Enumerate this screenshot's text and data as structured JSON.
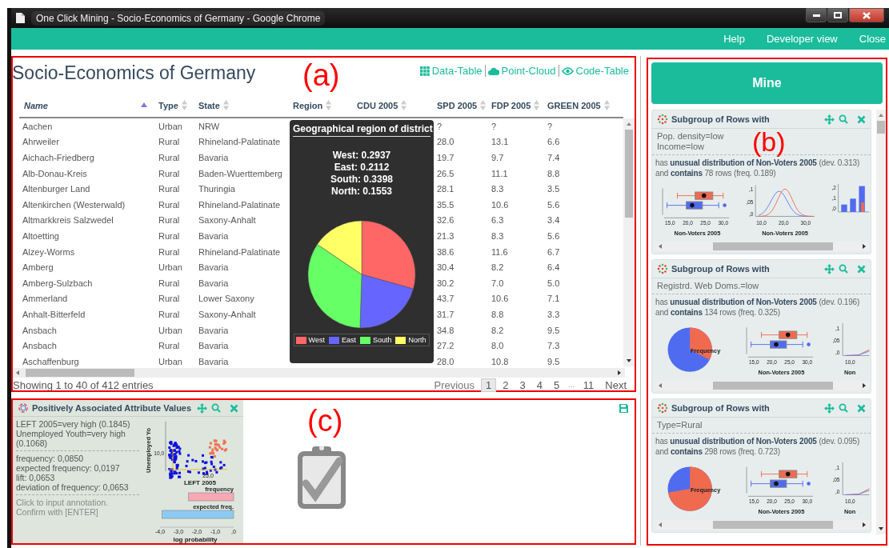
{
  "window": {
    "title": "One Click Mining - Socio-Economics of Germany - Google Chrome"
  },
  "navbar": {
    "links": [
      "Help",
      "Developer view",
      "Close"
    ]
  },
  "data_panel": {
    "marker": "(a)",
    "title": "Socio-Economics of Germany",
    "views": [
      {
        "label": "Data-Table",
        "kind": "grid"
      },
      {
        "label": "Point-Cloud",
        "kind": "cloud"
      },
      {
        "label": "Code-Table",
        "kind": "eye"
      }
    ],
    "table": {
      "columns": [
        {
          "label": "Name",
          "sorted": true
        },
        {
          "label": "Type",
          "sorted": false
        },
        {
          "label": "State",
          "sorted": false
        },
        {
          "label": "Region",
          "sorted": false
        },
        {
          "label": "CDU 2005",
          "sorted": false
        },
        {
          "label": "SPD 2005",
          "sorted": false
        },
        {
          "label": "FDP 2005",
          "sorted": false
        },
        {
          "label": "GREEN 2005",
          "sorted": false
        }
      ],
      "rows": [
        [
          "Aachen",
          "Urban",
          "NRW",
          "",
          "",
          "?",
          "?",
          "?"
        ],
        [
          "Ahrweiler",
          "Rural",
          "Rhineland-Palatinate",
          "",
          "",
          "28.0",
          "13.1",
          "6.6"
        ],
        [
          "Aichach-Friedberg",
          "Rural",
          "Bavaria",
          "",
          "",
          "19.7",
          "9.7",
          "7.4"
        ],
        [
          "Alb-Donau-Kreis",
          "Rural",
          "Baden-Wuerttemberg",
          "",
          "",
          "26.5",
          "11.1",
          "8.8"
        ],
        [
          "Altenburger Land",
          "Rural",
          "Thuringia",
          "",
          "",
          "28.1",
          "8.3",
          "3.5"
        ],
        [
          "Altenkirchen (Westerwald)",
          "Rural",
          "Rhineland-Palatinate",
          "",
          "",
          "35.5",
          "10.6",
          "5.6"
        ],
        [
          "Altmarkkreis Salzwedel",
          "Rural",
          "Saxony-Anhalt",
          "",
          "",
          "32.6",
          "6.3",
          "3.4"
        ],
        [
          "Altoetting",
          "Rural",
          "Bavaria",
          "",
          "",
          "21.3",
          "8.3",
          "5.6"
        ],
        [
          "Alzey-Worms",
          "Rural",
          "Rhineland-Palatinate",
          "",
          "",
          "38.6",
          "11.6",
          "6.7"
        ],
        [
          "Amberg",
          "Urban",
          "Bavaria",
          "",
          "",
          "30.4",
          "8.2",
          "6.4"
        ],
        [
          "Amberg-Sulzbach",
          "Rural",
          "Bavaria",
          "",
          "",
          "30.2",
          "7.0",
          "5.0"
        ],
        [
          "Ammerland",
          "Rural",
          "Lower Saxony",
          "",
          "",
          "43.7",
          "10.6",
          "7.1"
        ],
        [
          "Anhalt-Bitterfeld",
          "Rural",
          "Saxony-Anhalt",
          "",
          "",
          "31.7",
          "8.8",
          "3.3"
        ],
        [
          "Ansbach",
          "Urban",
          "Bavaria",
          "",
          "",
          "34.8",
          "8.2",
          "9.5"
        ],
        [
          "Ansbach",
          "Rural",
          "Bavaria",
          "",
          "",
          "27.2",
          "8.0",
          "7.3"
        ],
        [
          "Aschaffenburg",
          "Urban",
          "Bavaria",
          "",
          "",
          "28.0",
          "10.8",
          "9.5"
        ]
      ]
    },
    "tooltip": {
      "title": "Geographical region of district",
      "lines": [
        "West: 0.2937",
        "East: 0.2112",
        "South: 0.3398",
        "North: 0.1553"
      ],
      "chart_data": {
        "type": "pie",
        "categories": [
          "West",
          "East",
          "South",
          "North"
        ],
        "values": [
          0.2937,
          0.2112,
          0.3398,
          0.1553
        ],
        "colors": [
          "#ff6666",
          "#6666ff",
          "#66ff66",
          "#ffff66"
        ]
      }
    },
    "info": "Showing 1 to 40 of 412 entries",
    "pagination": {
      "previous": "Previous",
      "pages": [
        {
          "label": "1",
          "selected": true
        },
        {
          "label": "2",
          "selected": false
        },
        {
          "label": "3",
          "selected": false
        },
        {
          "label": "4",
          "selected": false
        },
        {
          "label": "5",
          "selected": false
        }
      ],
      "gap": "...",
      "last_pages": [
        {
          "label": "11",
          "selected": false
        }
      ],
      "next": "Next"
    }
  },
  "subgroup_panel": {
    "marker": "(b)",
    "mine_button": "Mine",
    "cards": [
      {
        "title": "Subgroup of Rows with",
        "conditions": [
          "Pop. density=low",
          "Income=low"
        ],
        "description": [
          "has **unusual distribution of Non-Voters 2005** (dev. 0.313)",
          "and **contains** 78 rows (freq. 0.189)"
        ],
        "plots": [
          {
            "kind": "boxplot",
            "x_ticks": [
              "15,0",
              "20,0",
              "25,0",
              "30,0"
            ],
            "xlabel": "Non-Voters 2005"
          },
          {
            "kind": "density",
            "y_ticks": [
              ",1",
              ",05",
              ",0"
            ],
            "x_ticks": [
              "10,0",
              "20,0",
              "30,0"
            ],
            "xlabel": "Non-Voters 2005"
          },
          {
            "kind": "bars",
            "y_ticks": [
              ",2",
              ",1",
              ",0"
            ]
          }
        ]
      },
      {
        "title": "Subgroup of Rows with",
        "conditions": [
          "Registrd. Web Doms.=low"
        ],
        "description": [
          "has **unusual distribution of Non-Voters 2005** (dev. 0.196)",
          "and **contains** 134 rows (freq. 0.325)"
        ],
        "plots": [
          {
            "kind": "pie",
            "label": "Frequency"
          },
          {
            "kind": "boxplot",
            "x_ticks": [
              "15,0",
              "20,0",
              "25,0",
              "30,0"
            ],
            "xlabel": "Non-Voters 2005"
          },
          {
            "kind": "line",
            "y_ticks": [
              ",1",
              ",05",
              ",0"
            ],
            "x_ticks": [
              "10,0"
            ],
            "xlabel": "Non"
          }
        ]
      },
      {
        "title": "Subgroup of Rows with",
        "conditions": [
          "Type=Rural"
        ],
        "description": [
          "has **unusual distribution of Non-Voters 2005** (dev. 0.095)",
          "and **contains** 298 rows (freq. 0.723)"
        ],
        "plots": [
          {
            "kind": "pie",
            "label": "Frequency"
          },
          {
            "kind": "boxplot",
            "x_ticks": [
              "15,0",
              "20,0",
              "25,0",
              "30,0"
            ],
            "xlabel": "Non-Voters 2005"
          },
          {
            "kind": "line",
            "y_ticks": [
              ",1",
              ",05",
              ",0"
            ],
            "x_ticks": [
              "10,0"
            ],
            "xlabel": "Non"
          }
        ]
      }
    ]
  },
  "assoc_panel": {
    "marker": "(c)",
    "card": {
      "title": "Positively Associated Attribute Values",
      "patterns": [
        "LEFT 2005=very high (0.1845)",
        "Unemployed Youth=very high (0.1068)"
      ],
      "stats": [
        "frequency: 0,0850",
        "expected frequency: 0,0197",
        "lift: 0,0653",
        "deviation of frequency: 0,0653"
      ],
      "annotation": {
        "placeholder": "Click to input annotation. Confirm with [ENTER]"
      },
      "scatter": {
        "ylabel": "Unemployed Yo",
        "y_ticks": [
          "10,0"
        ],
        "x_ticks": [
          "25,0"
        ],
        "xlabel": "LEFT 2005"
      },
      "chart_data": {
        "type": "bar",
        "orientation": "horizontal",
        "categories": [
          "frequency",
          "expected freq."
        ],
        "values": [
          -2.45,
          -3.9
        ],
        "colors": [
          "#f7a8b4",
          "#8ccaf2"
        ],
        "xlabel": "log probability",
        "xlim": [
          -4,
          0
        ],
        "xticks": [
          {
            "value": -4,
            "label": "-4,0"
          },
          {
            "value": -3,
            "label": "-3,0"
          },
          {
            "value": -2,
            "label": "-2,0"
          },
          {
            "value": -1,
            "label": "-1,0"
          },
          {
            "value": 0,
            "label": ",0"
          }
        ]
      }
    }
  }
}
